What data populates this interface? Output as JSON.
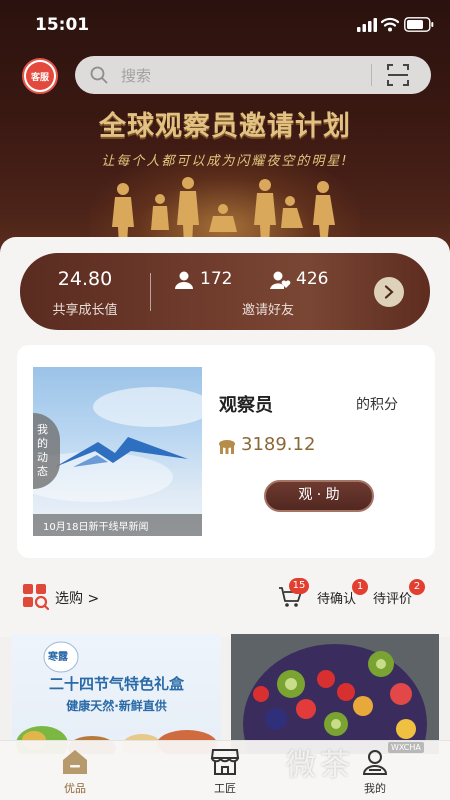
{
  "status_bar": {
    "time": "15:01",
    "icons": [
      "signal-icon",
      "wifi-icon",
      "battery-icon"
    ]
  },
  "header": {
    "service_label": "客服",
    "search_placeholder": "搜索",
    "icons": [
      "search-icon",
      "scan-icon"
    ]
  },
  "banner": {
    "title": "全球观察员邀请计划",
    "slogan": "让每个人都可以成为闪耀夜空的明星!"
  },
  "stats": {
    "growth_value": "24.80",
    "growth_label": "共享成长值",
    "count_a": "172",
    "count_b": "426",
    "invite_label": "邀请好友"
  },
  "observer": {
    "news_caption": "10月18日新干线早新闻",
    "dynamic_tab": [
      "我",
      "的",
      "动",
      "态"
    ],
    "title": "观察员",
    "points_label": "的积分",
    "points_value": "3189.12",
    "help_button": "观 · 助"
  },
  "shop": {
    "label": "选购 >",
    "cart_badge": "15",
    "confirm_label": "待确认",
    "confirm_badge": "1",
    "review_label": "待评价",
    "review_badge": "2"
  },
  "products": [
    {
      "badge": "寒露",
      "title": "二十四节气特色礼盒",
      "subtitle": "健康天然·新鲜直供"
    },
    {
      "image": "fruit-bowl"
    }
  ],
  "tabs": [
    {
      "label": "优品",
      "icon": "home-icon",
      "active": true
    },
    {
      "label": "工匠",
      "icon": "store-icon",
      "active": false
    },
    {
      "label": "我的",
      "icon": "profile-icon",
      "active": false
    }
  ],
  "watermark": {
    "text": "微茶",
    "sub": "WXCHA"
  },
  "colors": {
    "accent_brown": "#5a2b20",
    "gold": "#8b6936",
    "badge_red": "#e23f31"
  }
}
